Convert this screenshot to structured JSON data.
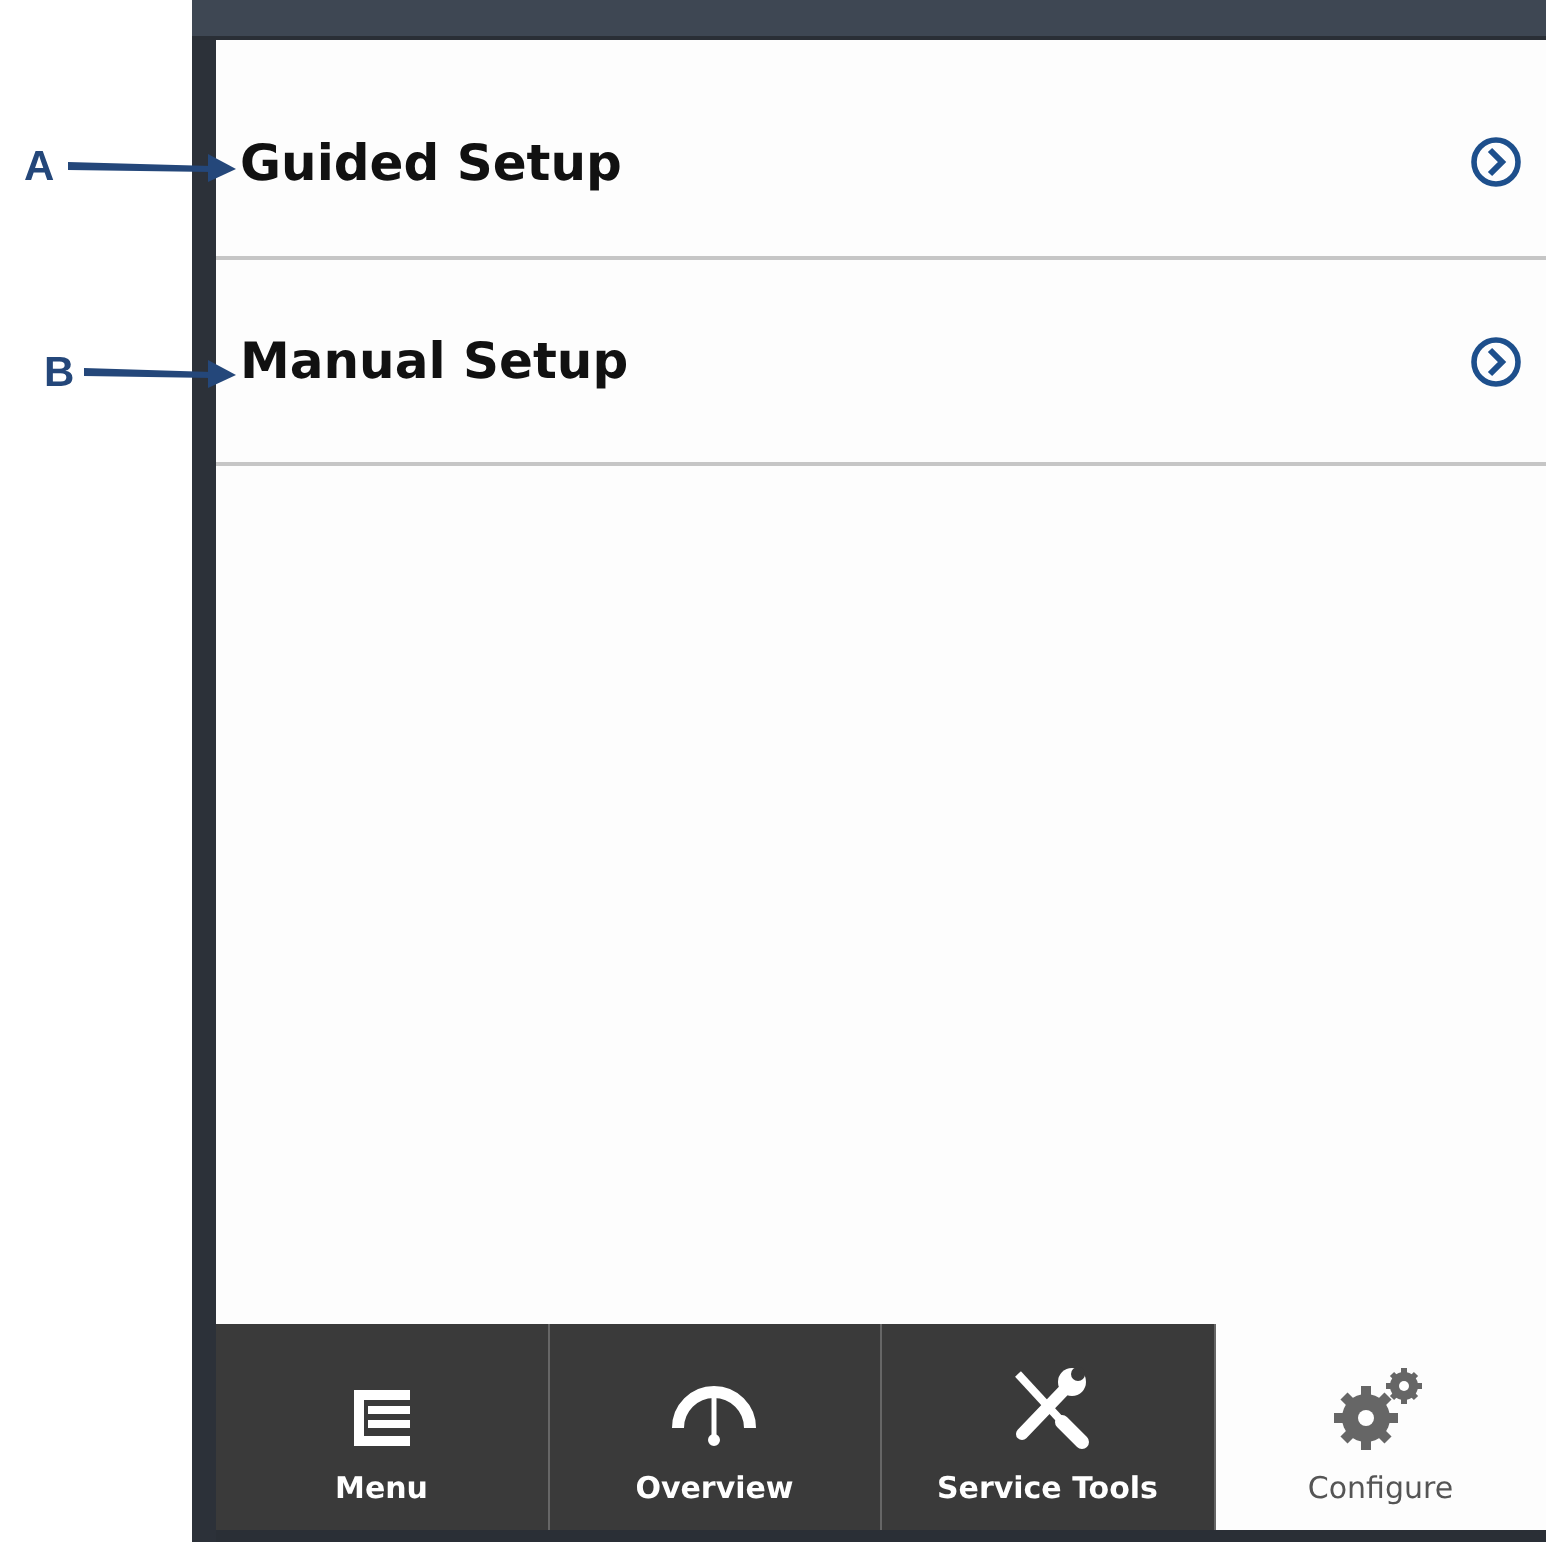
{
  "callouts": [
    {
      "label": "A"
    },
    {
      "label": "B"
    }
  ],
  "setup_items": [
    {
      "label": "Guided Setup"
    },
    {
      "label": "Manual Setup"
    }
  ],
  "tabs": [
    {
      "label": "Menu",
      "kind": "menu",
      "selected": false
    },
    {
      "label": "Overview",
      "kind": "gauge",
      "selected": false
    },
    {
      "label": "Service Tools",
      "kind": "tools",
      "selected": false
    },
    {
      "label": "Configure",
      "kind": "gears",
      "selected": true
    }
  ]
}
